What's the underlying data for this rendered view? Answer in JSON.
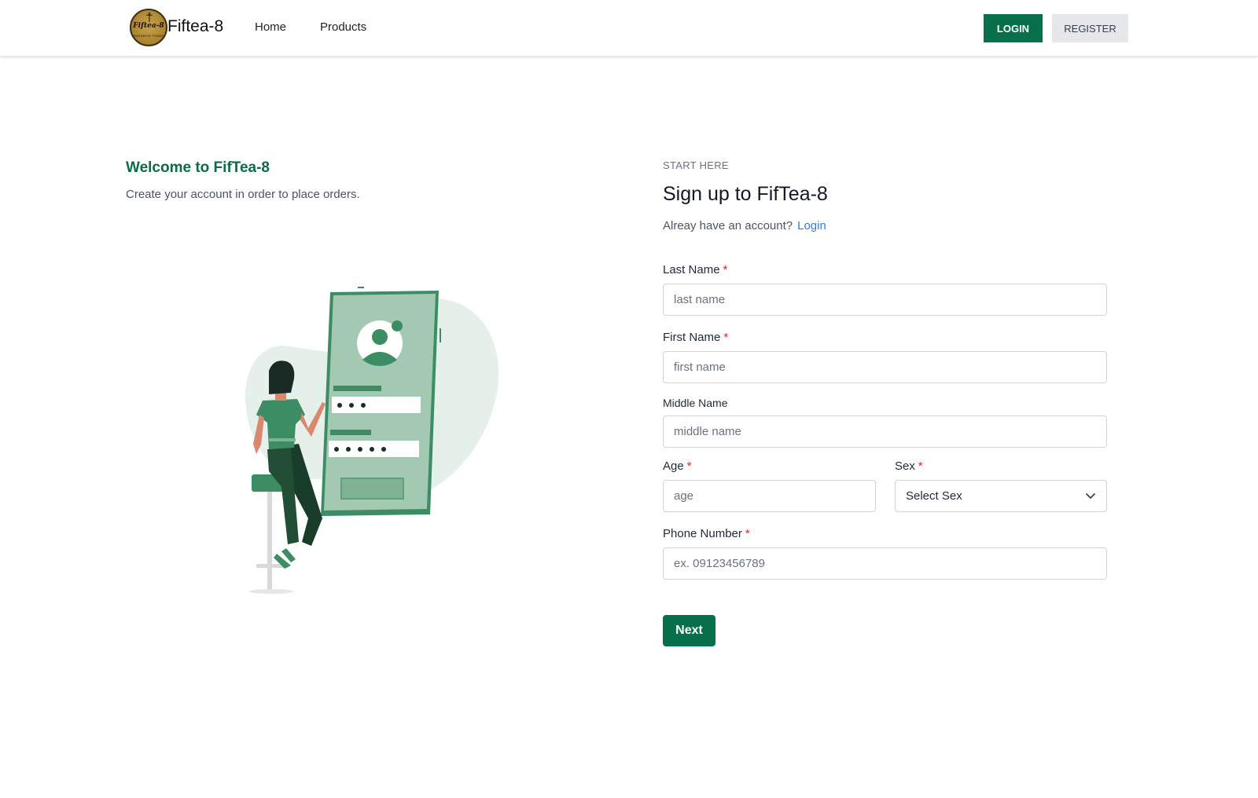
{
  "header": {
    "brand": "Fiftea-8",
    "logo_text": "Fiftea-8",
    "logo_subtext": "BUSINESS TRADE",
    "nav": [
      {
        "label": "Home"
      },
      {
        "label": "Products"
      }
    ],
    "login_label": "LOGIN",
    "register_label": "REGISTER"
  },
  "intro": {
    "title": "Welcome to FifTea-8",
    "subtitle": "Create your account in order to place orders."
  },
  "form": {
    "eyebrow": "START HERE",
    "title": "Sign up to FifTea-8",
    "have_account": "Alreay have an account?",
    "login_link": "Login",
    "last_name": {
      "label": "Last Name",
      "required": "*",
      "placeholder": "last name",
      "value": ""
    },
    "first_name": {
      "label": "First Name",
      "required": "*",
      "placeholder": "first name",
      "value": ""
    },
    "middle_name": {
      "label": "Middle Name",
      "placeholder": "middle name",
      "value": ""
    },
    "age": {
      "label": "Age",
      "required": "*",
      "placeholder": "age",
      "value": ""
    },
    "sex": {
      "label": "Sex",
      "required": "*",
      "selected": "Select Sex"
    },
    "phone": {
      "label": "Phone Number",
      "required": "*",
      "placeholder": "ex. 09123456789",
      "value": ""
    },
    "next_label": "Next"
  },
  "colors": {
    "primary": "#07704b",
    "link": "#3b7bd6",
    "required": "#dc2626",
    "illustration_green": "#4a9a6e"
  }
}
